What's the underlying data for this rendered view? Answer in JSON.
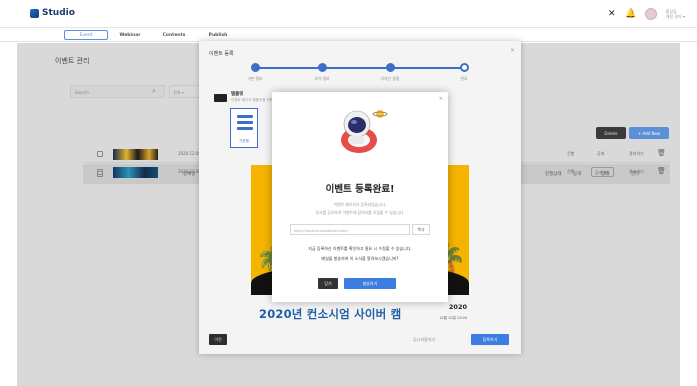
{
  "app": {
    "name": "Studio",
    "icons": [
      "grid-icon",
      "bell-icon",
      "avatar"
    ]
  },
  "user": {
    "name": "홍길동",
    "sub": "계정 관리 ▾"
  },
  "nav": {
    "tabs": [
      "Event",
      "Webinar",
      "Contents",
      "Publish"
    ],
    "active": "Event"
  },
  "page": {
    "title": "이벤트 관리",
    "search_placeholder": "Search",
    "filter_label": "전체 ▾",
    "btn_dark": "Delete",
    "btn_blue": "+ Add New",
    "table": {
      "headers": [
        "썸네일이미지",
        "등록일",
        "진행상태",
        "공개",
        "상태",
        "관리"
      ],
      "rows": [
        {
          "date": "2020.12.08",
          "status": "진행",
          "tag": "공개",
          "tag2": "관리하기"
        },
        {
          "date": "2020.12.08",
          "status": "진행",
          "tag": "공개하기",
          "tag2": "관리하기"
        }
      ]
    }
  },
  "wizard": {
    "title": "이벤트 등록",
    "steps": [
      "기본 정보",
      "부가 정보",
      "디자인 설정",
      "완료"
    ],
    "section_title": "템플릿",
    "section_desc": "이벤트 페이지 템플릿을 선택하세요",
    "thumb_label": "기본형",
    "heading": "2020년 컨소시엄 사이버 캠",
    "year": "2020",
    "date": "12월 10일 13:00",
    "prev_label": "이전",
    "save_label": "임시저장하기",
    "next_label": "등록하기"
  },
  "dialog": {
    "title": "이벤트 등록완료!",
    "line1": "이벤트 페이지가 등록되었습니다.",
    "line2": "링크를 공유하여 이벤트에 참여자를 모집할 수 있습니다.",
    "url": "http://www.monaddoor.com/",
    "copy_label": "복사",
    "msg1": "지금 등록하신 이벤트를 확인하고 필요 시 수정할 수 있습니다.",
    "msg2": "메일을 발송하여 이 소식을 알려보시겠습니까?",
    "close_label": "닫기",
    "go_label": "발송하기"
  }
}
